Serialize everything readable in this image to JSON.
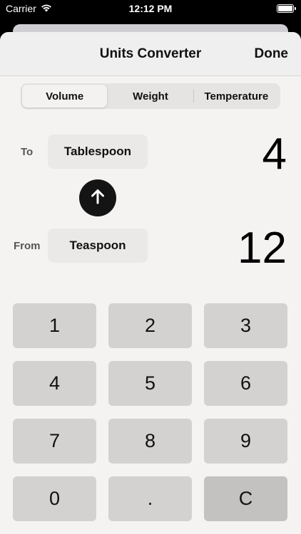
{
  "status_bar": {
    "carrier": "Carrier",
    "time": "12:12 PM",
    "wifi_icon": "wifi-icon",
    "battery_icon": "battery-icon"
  },
  "nav": {
    "title": "Units Converter",
    "done_label": "Done"
  },
  "segments": [
    {
      "label": "Volume",
      "selected": true
    },
    {
      "label": "Weight",
      "selected": false
    },
    {
      "label": "Temperature",
      "selected": false
    }
  ],
  "to": {
    "label": "To",
    "unit": "Tablespoon",
    "value": "4"
  },
  "from": {
    "label": "From",
    "unit": "Teaspoon",
    "value": "12"
  },
  "swap_icon": "arrow-up-icon",
  "keypad": [
    "1",
    "2",
    "3",
    "4",
    "5",
    "6",
    "7",
    "8",
    "9",
    "0",
    ".",
    "C"
  ],
  "colors": {
    "background": "#f5f2f2",
    "key": "#d4d1d1",
    "clear_key": "#c4c1c1",
    "swap_button": "#141414"
  }
}
